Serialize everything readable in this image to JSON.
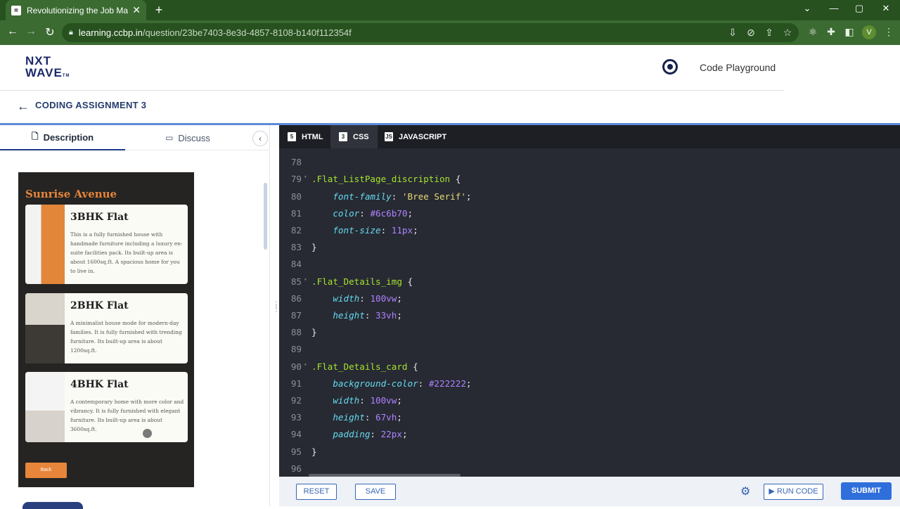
{
  "browser": {
    "tab_title": "Revolutionizing the Job Market |",
    "tab_close": "✕",
    "new_tab": "+",
    "url_host": "learning.ccbp.in",
    "url_path": "/question/23be7403-8e3d-4857-8108-b140f112354f",
    "profile_initial": "V",
    "window_controls": [
      "⌄",
      "—",
      "▢",
      "✕"
    ],
    "icons": [
      "install-icon",
      "eye-off-icon",
      "share-icon",
      "star-icon",
      "react-extension-icon",
      "puzzle-extension-icon",
      "sidebar-icon",
      "profile-avatar",
      "kebab-menu-icon"
    ]
  },
  "header": {
    "logo_line1": "NXT",
    "logo_line2": "WAVE",
    "logo_tm": "TM",
    "playground_label": "Code Playground"
  },
  "assignment": {
    "title": "CODING ASSIGNMENT 3"
  },
  "left_panel": {
    "tab_description": "Description",
    "tab_discuss": "Discuss",
    "collapse": "‹",
    "preview": {
      "heading": "Sunrise Avenue",
      "cards": [
        {
          "title": "3BHK Flat",
          "desc": "This is a fully furnished house with handmade furniture including a luxury en-suite facilities pack. Its built-up area is about 1600sq.ft. A spacious home for you to live in."
        },
        {
          "title": "2BHK Flat",
          "desc": "A minimalist house mode for modern-day families. It is fully furnished with trending furniture. Its built-up area is about 1200sq.ft."
        },
        {
          "title": "4BHK Flat",
          "desc": "A contemporary home with more color and vibrancy. It is fully furnished with elegant furniture. Its built-up area is about 3600sq.ft."
        }
      ],
      "back_label": "Back"
    }
  },
  "editor": {
    "tabs": [
      {
        "label": "HTML",
        "icon": "5"
      },
      {
        "label": "CSS",
        "icon": "3"
      },
      {
        "label": "JAVASCRIPT",
        "icon": "JS"
      }
    ],
    "lines": [
      {
        "n": "",
        "html": ""
      },
      {
        "n": "78",
        "html": ""
      },
      {
        "n": "79",
        "fold": true,
        "html": "<span class='sel'>.Flat_ListPage_discription</span> <span class='pun'>{</span>"
      },
      {
        "n": "80",
        "html": "    <span class='prop'>font-family</span><span class='pun'>: </span><span class='str'>'Bree Serif'</span><span class='pun'>;</span>"
      },
      {
        "n": "81",
        "html": "    <span class='prop'>color</span><span class='pun'>: </span><span class='num'>#6c6b70</span><span class='pun'>;</span>"
      },
      {
        "n": "82",
        "html": "    <span class='prop'>font-size</span><span class='pun'>: </span><span class='num'>11px</span><span class='pun'>;</span>"
      },
      {
        "n": "83",
        "html": "<span class='pun'>}</span>"
      },
      {
        "n": "84",
        "html": ""
      },
      {
        "n": "85",
        "fold": true,
        "html": "<span class='sel'>.Flat_Details_img</span> <span class='pun'>{</span>"
      },
      {
        "n": "86",
        "html": "    <span class='prop'>width</span><span class='pun'>: </span><span class='num'>100vw</span><span class='pun'>;</span>"
      },
      {
        "n": "87",
        "html": "    <span class='prop'>height</span><span class='pun'>: </span><span class='num'>33vh</span><span class='pun'>;</span>"
      },
      {
        "n": "88",
        "html": "<span class='pun'>}</span>"
      },
      {
        "n": "89",
        "html": ""
      },
      {
        "n": "90",
        "fold": true,
        "html": "<span class='sel'>.Flat_Details_card</span> <span class='pun'>{</span>"
      },
      {
        "n": "91",
        "html": "    <span class='prop'>background-color</span><span class='pun'>: </span><span class='num'>#222222</span><span class='pun'>;</span>"
      },
      {
        "n": "92",
        "html": "    <span class='prop'>width</span><span class='pun'>: </span><span class='num'>100vw</span><span class='pun'>;</span>"
      },
      {
        "n": "93",
        "html": "    <span class='prop'>height</span><span class='pun'>: </span><span class='num'>67vh</span><span class='pun'>;</span>"
      },
      {
        "n": "94",
        "html": "    <span class='prop'>padding</span><span class='pun'>: </span><span class='num'>22px</span><span class='pun'>;</span>"
      },
      {
        "n": "95",
        "html": "<span class='pun'>}</span>"
      },
      {
        "n": "96",
        "html": ""
      }
    ]
  },
  "actions": {
    "reset": "RESET",
    "save": "SAVE",
    "run": "▶ RUN CODE",
    "submit": "SUBMIT"
  },
  "colors": {
    "chrome": "#3b6b31",
    "accent": "#2f6fdc",
    "preview_orange": "#e7853a"
  }
}
